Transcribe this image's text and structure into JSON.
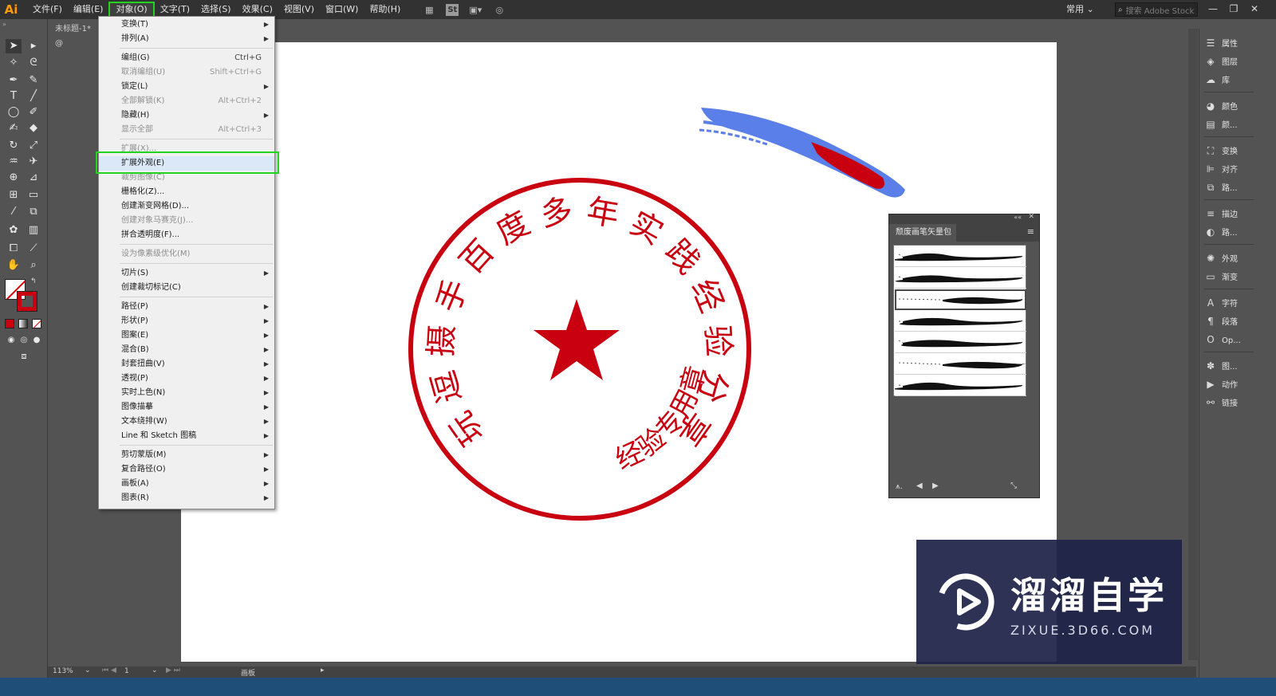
{
  "app": {
    "logo": "Ai",
    "doc_tab": "未标题-1* @"
  },
  "menubar": {
    "items": [
      "文件(F)",
      "编辑(E)",
      "对象(O)",
      "文字(T)",
      "选择(S)",
      "效果(C)",
      "视图(V)",
      "窗口(W)",
      "帮助(H)"
    ],
    "active_index": 2,
    "st_icon": "St",
    "workspace": "常用",
    "search_placeholder": "搜索 Adobe Stock"
  },
  "object_menu": {
    "items": [
      {
        "label": "变换(T)",
        "shortcut": "",
        "submenu": true,
        "disabled": false
      },
      {
        "label": "排列(A)",
        "shortcut": "",
        "submenu": true,
        "disabled": false
      },
      {
        "sep": true
      },
      {
        "label": "编组(G)",
        "shortcut": "Ctrl+G",
        "submenu": false,
        "disabled": false
      },
      {
        "label": "取消编组(U)",
        "shortcut": "Shift+Ctrl+G",
        "submenu": false,
        "disabled": true
      },
      {
        "label": "锁定(L)",
        "shortcut": "",
        "submenu": true,
        "disabled": false
      },
      {
        "label": "全部解锁(K)",
        "shortcut": "Alt+Ctrl+2",
        "submenu": false,
        "disabled": true
      },
      {
        "label": "隐藏(H)",
        "shortcut": "",
        "submenu": true,
        "disabled": false
      },
      {
        "label": "显示全部",
        "shortcut": "Alt+Ctrl+3",
        "submenu": false,
        "disabled": true
      },
      {
        "sep": true
      },
      {
        "label": "扩展(X)...",
        "shortcut": "",
        "submenu": false,
        "disabled": true
      },
      {
        "label": "扩展外观(E)",
        "shortcut": "",
        "submenu": false,
        "disabled": false,
        "hot": true
      },
      {
        "label": "裁剪图像(C)",
        "shortcut": "",
        "submenu": false,
        "disabled": true
      },
      {
        "label": "栅格化(Z)...",
        "shortcut": "",
        "submenu": false,
        "disabled": false
      },
      {
        "label": "创建渐变网格(D)...",
        "shortcut": "",
        "submenu": false,
        "disabled": false
      },
      {
        "label": "创建对象马赛克(J)...",
        "shortcut": "",
        "submenu": false,
        "disabled": true
      },
      {
        "label": "拼合透明度(F)...",
        "shortcut": "",
        "submenu": false,
        "disabled": false
      },
      {
        "sep": true
      },
      {
        "label": "设为像素级优化(M)",
        "shortcut": "",
        "submenu": false,
        "disabled": true
      },
      {
        "sep": true
      },
      {
        "label": "切片(S)",
        "shortcut": "",
        "submenu": true,
        "disabled": false
      },
      {
        "label": "创建裁切标记(C)",
        "shortcut": "",
        "submenu": false,
        "disabled": false
      },
      {
        "sep": true
      },
      {
        "label": "路径(P)",
        "shortcut": "",
        "submenu": true,
        "disabled": false
      },
      {
        "label": "形状(P)",
        "shortcut": "",
        "submenu": true,
        "disabled": false
      },
      {
        "label": "图案(E)",
        "shortcut": "",
        "submenu": true,
        "disabled": false
      },
      {
        "label": "混合(B)",
        "shortcut": "",
        "submenu": true,
        "disabled": false
      },
      {
        "label": "封套扭曲(V)",
        "shortcut": "",
        "submenu": true,
        "disabled": false
      },
      {
        "label": "透视(P)",
        "shortcut": "",
        "submenu": true,
        "disabled": false
      },
      {
        "label": "实时上色(N)",
        "shortcut": "",
        "submenu": true,
        "disabled": false
      },
      {
        "label": "图像描摹",
        "shortcut": "",
        "submenu": true,
        "disabled": false
      },
      {
        "label": "文本绕排(W)",
        "shortcut": "",
        "submenu": true,
        "disabled": false
      },
      {
        "label": "Line 和 Sketch 图稿",
        "shortcut": "",
        "submenu": true,
        "disabled": false
      },
      {
        "sep": true
      },
      {
        "label": "剪切蒙版(M)",
        "shortcut": "",
        "submenu": true,
        "disabled": false
      },
      {
        "label": "复合路径(O)",
        "shortcut": "",
        "submenu": true,
        "disabled": false
      },
      {
        "label": "画板(A)",
        "shortcut": "",
        "submenu": true,
        "disabled": false
      },
      {
        "label": "图表(R)",
        "shortcut": "",
        "submenu": true,
        "disabled": false
      }
    ]
  },
  "stamp": {
    "ring_text": "玩逗摄手百度多年实践经验分享",
    "bottom_text": "经验专用章",
    "color": "#c8000f"
  },
  "brush_panel": {
    "title": "颓废画笔矢量包",
    "count": 7,
    "selected_index": 2
  },
  "right_dock": {
    "items": [
      {
        "icon": "properties-icon",
        "glyph": "☰",
        "label": "属性"
      },
      {
        "icon": "layers-icon",
        "glyph": "◈",
        "label": "图层"
      },
      {
        "icon": "libraries-icon",
        "glyph": "☁",
        "label": "库"
      },
      {
        "icon": "color-icon",
        "glyph": "◕",
        "label": "颜色"
      },
      {
        "icon": "swatches-icon",
        "glyph": "▤",
        "label": "颜..."
      },
      {
        "icon": "transform-icon",
        "glyph": "⛶",
        "label": "变换"
      },
      {
        "icon": "align-icon",
        "glyph": "⊫",
        "label": "对齐"
      },
      {
        "icon": "pathfinder-icon",
        "glyph": "⧉",
        "label": "路..."
      },
      {
        "icon": "stroke-icon",
        "glyph": "≡",
        "label": "描边"
      },
      {
        "icon": "transparency-icon",
        "glyph": "◐",
        "label": "路..."
      },
      {
        "icon": "appearance-icon",
        "glyph": "✺",
        "label": "外观"
      },
      {
        "icon": "gradient-icon",
        "glyph": "▭",
        "label": "渐变"
      },
      {
        "icon": "character-icon",
        "glyph": "A",
        "label": "字符"
      },
      {
        "icon": "paragraph-icon",
        "glyph": "¶",
        "label": "段落"
      },
      {
        "icon": "opentype-icon",
        "glyph": "O",
        "label": "Op..."
      },
      {
        "icon": "symbols-icon",
        "glyph": "✽",
        "label": "图..."
      },
      {
        "icon": "actions-icon",
        "glyph": "▶",
        "label": "动作"
      },
      {
        "icon": "links-icon",
        "glyph": "⚯",
        "label": "链接"
      }
    ]
  },
  "status": {
    "zoom": "113%",
    "artboard_num": "1",
    "mode": "画板"
  },
  "watermark": {
    "brand": "溜溜自学",
    "url": "ZIXUE.3D66.COM"
  }
}
